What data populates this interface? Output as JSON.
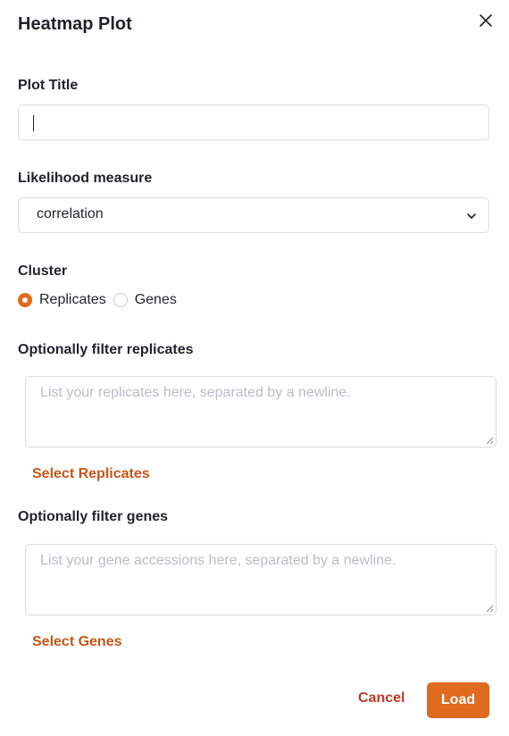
{
  "dialog": {
    "title": "Heatmap Plot",
    "close_icon": "close-icon"
  },
  "plot_title": {
    "label": "Plot Title",
    "value": ""
  },
  "likelihood": {
    "label": "Likelihood measure",
    "selected": "correlation"
  },
  "cluster": {
    "label": "Cluster",
    "options": [
      {
        "label": "Replicates",
        "checked": true
      },
      {
        "label": "Genes",
        "checked": false
      }
    ]
  },
  "replicates_filter": {
    "label": "Optionally filter replicates",
    "placeholder": "List your replicates here, separated by a newline.",
    "select_label": "Select Replicates"
  },
  "genes_filter": {
    "label": "Optionally filter genes",
    "placeholder": "List your gene accessions here, separated by a newline.",
    "select_label": "Select Genes"
  },
  "footer": {
    "cancel_label": "Cancel",
    "load_label": "Load"
  },
  "colors": {
    "accent": "#e06a1d",
    "link": "#c75618",
    "cancel": "#c0392b",
    "border": "#dadde1",
    "placeholder": "#b9bec4"
  }
}
